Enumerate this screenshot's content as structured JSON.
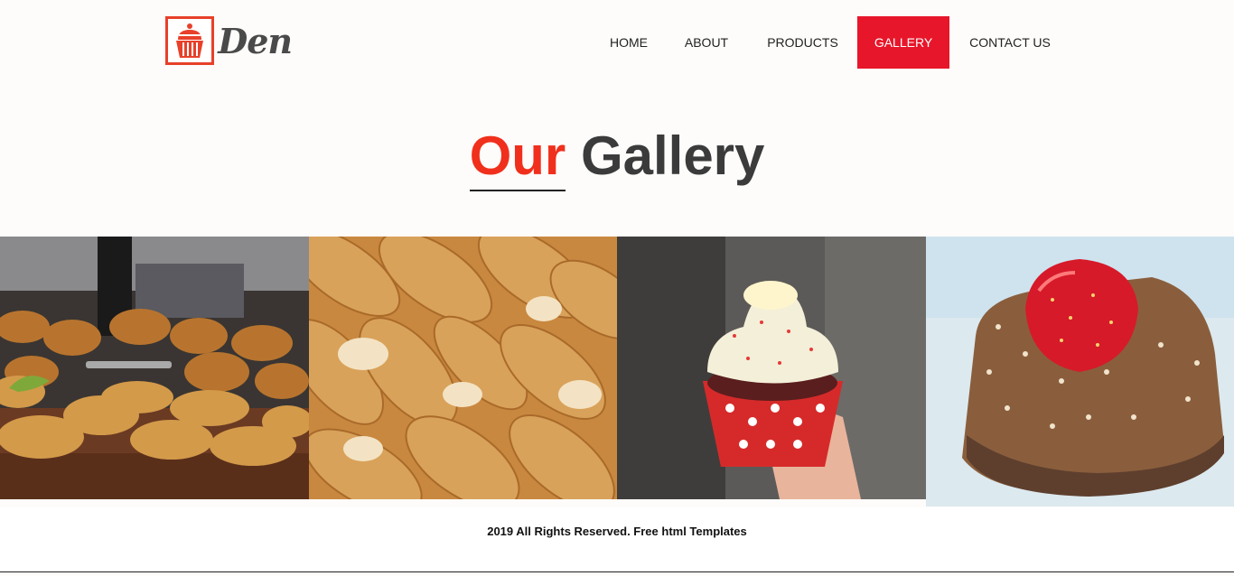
{
  "brand": {
    "name": "Den",
    "icon": "cupcake-icon",
    "accent_color": "#e8402a"
  },
  "nav": {
    "items": [
      {
        "label": "HOME",
        "active": false
      },
      {
        "label": "ABOUT",
        "active": false
      },
      {
        "label": "PRODUCTS",
        "active": false
      },
      {
        "label": "GALLERY",
        "active": true
      },
      {
        "label": "CONTACT US",
        "active": false
      }
    ],
    "active_color": "#e8162a"
  },
  "page": {
    "title_accent": "Our",
    "title_rest": "Gallery"
  },
  "gallery": {
    "images": [
      {
        "subject": "croissants-and-pastries"
      },
      {
        "subject": "sesame-bread-rolls"
      },
      {
        "subject": "cupcake-in-hand"
      },
      {
        "subject": "strawberry-coconut-cake"
      }
    ]
  },
  "footer": {
    "text": "2019 All Rights Reserved. Free html Templates"
  }
}
